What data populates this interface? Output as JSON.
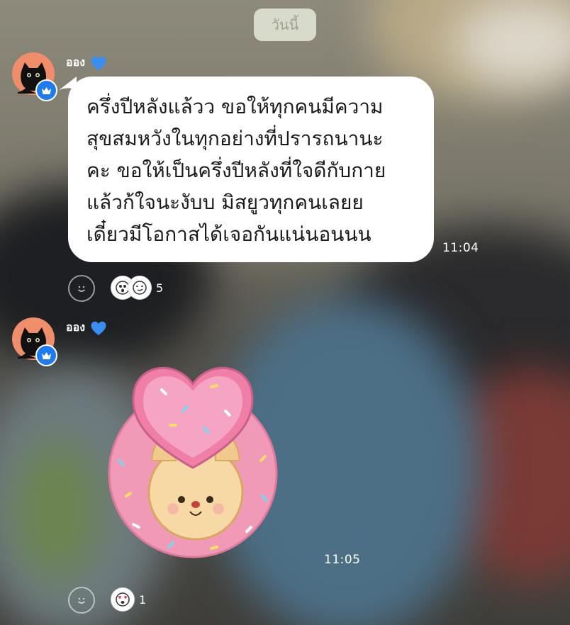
{
  "date_separator": "วันนี้",
  "messages": [
    {
      "sender": "ออง",
      "type": "text",
      "lines": [
        "ครึ่งปีหลังแล้วว ขอให้ทุกคนมีความ",
        "สุขสมหวังในทุกอย่างที่ปรารถนานะ",
        "คะ ขอให้เป็นครึ่งปีหลังที่ใจดีกับกาย",
        "แล้วก้ใจนะงับบ มิสยูวทุกคนเลยย",
        "เดี๋ยวมีโอกาสได้เจอกันแน่นอนนน"
      ],
      "time": "11:04",
      "reaction_count": "5",
      "reaction_icons": [
        "ghost-face-icon",
        "smirk-face-icon"
      ]
    },
    {
      "sender": "ออง",
      "type": "sticker",
      "sticker_icon": "heart-donut-puppy-sticker",
      "time": "11:05",
      "reaction_count": "1",
      "reaction_icons": [
        "heart-eyes-face-icon"
      ]
    }
  ],
  "icons": {
    "avatar": "black-cat-icon",
    "badge": "crown-icon",
    "name_emoji": "blue-heart-icon",
    "add_reaction": "smiley-icon"
  },
  "colors": {
    "badge_blue": "#1f7bf0",
    "heart_blue": "#3a8ef2",
    "avatar_bg": "#f08d6b",
    "bubble_bg": "#ffffff",
    "sticker_pink": "#f19ab7"
  }
}
